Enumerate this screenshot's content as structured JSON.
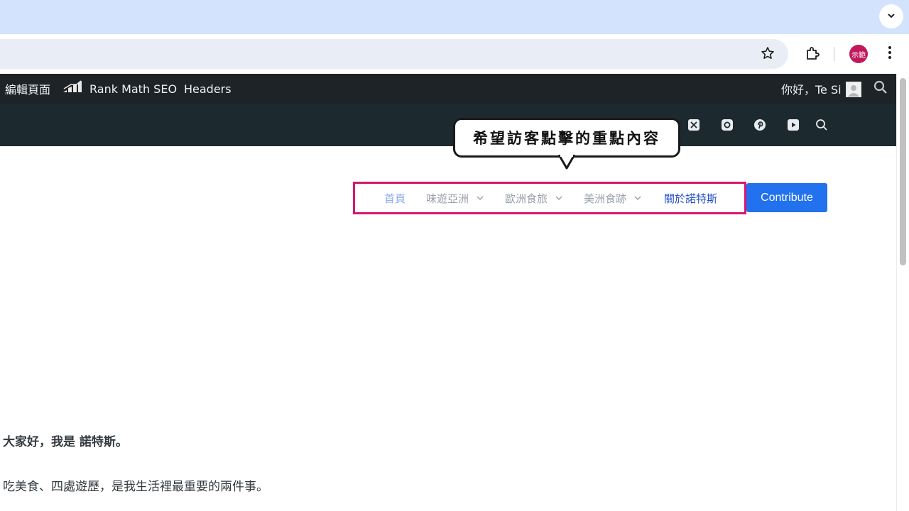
{
  "browser": {
    "profile_label": "示範",
    "icons": [
      "chevron-down-icon",
      "star-icon",
      "puzzle-icon",
      "kebab-menu-icon"
    ]
  },
  "admin_bar": {
    "edit_page": "編輯頁面",
    "rank_math": "Rank Math SEO",
    "headers": "Headers",
    "greeting": "你好，Te Si"
  },
  "site_header": {
    "social_icons": [
      "x-icon",
      "instagram-icon",
      "pinterest-icon",
      "youtube-icon",
      "search-icon"
    ]
  },
  "callout": {
    "text": "希望訪客點擊的重點內容",
    "highlight_color": "#d6176d"
  },
  "nav": {
    "items": [
      {
        "label": "首頁",
        "has_dropdown": false
      },
      {
        "label": "味遊亞洲",
        "has_dropdown": true
      },
      {
        "label": "歐洲食旅",
        "has_dropdown": true
      },
      {
        "label": "美洲食跡",
        "has_dropdown": true
      },
      {
        "label": "關於諾特斯",
        "has_dropdown": false
      }
    ],
    "contribute": "Contribute",
    "accent": "#2271ee"
  },
  "content": {
    "greeting": "大家好，我是 諾特斯。",
    "intro": "吃美食、四處遊歷，是我生活裡最重要的兩件事。"
  }
}
